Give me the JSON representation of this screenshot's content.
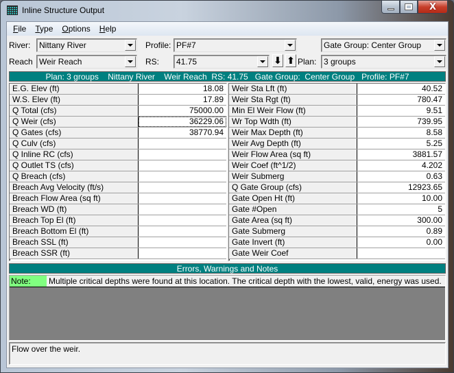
{
  "window": {
    "title": "Inline Structure Output",
    "close_glyph": "X"
  },
  "menu": [
    {
      "label": "File",
      "accel": "F",
      "rest": "ile"
    },
    {
      "label": "Type",
      "accel": "T",
      "rest": "ype"
    },
    {
      "label": "Options",
      "accel": "O",
      "rest": "ptions"
    },
    {
      "label": "Help",
      "accel": "H",
      "rest": "elp"
    }
  ],
  "selectors": {
    "river_label": "River:",
    "river_value": "Nittany River",
    "reach_label": "Reach",
    "reach_value": "Weir Reach",
    "profile_label": "Profile:",
    "profile_value": "PF#7",
    "rs_label": "RS:",
    "rs_value": "41.75",
    "gate_group_value": "Gate Group:  Center Group",
    "plan_label": "Plan:",
    "plan_value": "3 groups",
    "down_arrow": "⬇",
    "up_arrow": "⬆"
  },
  "plan_banner": "Plan: 3 groups    Nittany River    Weir Reach  RS: 41.75   Gate Group:  Center Group   Profile: PF#7",
  "left_table": [
    {
      "label": "E.G. Elev (ft)",
      "value": "18.08"
    },
    {
      "label": "W.S. Elev (ft)",
      "value": "17.89"
    },
    {
      "label": "Q Total (cfs)",
      "value": "75000.00"
    },
    {
      "label": "Q Weir (cfs)",
      "value": "36229.06"
    },
    {
      "label": "Q Gates (cfs)",
      "value": "38770.94"
    },
    {
      "label": "Q Culv (cfs)",
      "value": ""
    },
    {
      "label": "Q Inline RC (cfs)",
      "value": ""
    },
    {
      "label": "Q Outlet TS (cfs)",
      "value": ""
    },
    {
      "label": "Q Breach (cfs)",
      "value": ""
    },
    {
      "label": "Breach Avg Velocity (ft/s)",
      "value": ""
    },
    {
      "label": "Breach Flow Area (sq ft)",
      "value": ""
    },
    {
      "label": "Breach WD (ft)",
      "value": ""
    },
    {
      "label": "Breach Top El (ft)",
      "value": ""
    },
    {
      "label": "Breach Bottom El (ft)",
      "value": ""
    },
    {
      "label": "Breach SSL (ft)",
      "value": ""
    },
    {
      "label": "Breach SSR (ft)",
      "value": ""
    }
  ],
  "right_table": [
    {
      "label": "Weir Sta Lft (ft)",
      "value": "40.52"
    },
    {
      "label": "Weir Sta Rgt (ft)",
      "value": "780.47"
    },
    {
      "label": "Min El Weir Flow (ft)",
      "value": "9.51"
    },
    {
      "label": "Wr Top Wdth (ft)",
      "value": "739.95"
    },
    {
      "label": "Weir Max Depth (ft)",
      "value": "8.58"
    },
    {
      "label": "Weir Avg Depth (ft)",
      "value": "5.25"
    },
    {
      "label": "Weir Flow Area (sq ft)",
      "value": "3881.57"
    },
    {
      "label": "Weir Coef (ft^1/2)",
      "value": "4.202"
    },
    {
      "label": "Weir Submerg",
      "value": "0.63"
    },
    {
      "label": "Q Gate Group (cfs)",
      "value": "12923.65"
    },
    {
      "label": "Gate Open Ht (ft)",
      "value": "10.00"
    },
    {
      "label": "Gate #Open",
      "value": "5"
    },
    {
      "label": "Gate Area (sq ft)",
      "value": "300.00"
    },
    {
      "label": "Gate Submerg",
      "value": "0.89"
    },
    {
      "label": "Gate Invert (ft)",
      "value": "0.00"
    },
    {
      "label": "Gate Weir Coef",
      "value": ""
    }
  ],
  "errors_banner": "Errors, Warnings and Notes",
  "notes": [
    {
      "tag": "Note:",
      "text": "Multiple critical depths were found at this location.  The critical depth with the lowest, valid, energy was used.",
      "tag_color": "#80ff80"
    }
  ],
  "status_text": "Flow over the weir.",
  "colors": {
    "banner": "#008080",
    "note_tag": "#80ff80",
    "notes_bg": "#808080"
  }
}
